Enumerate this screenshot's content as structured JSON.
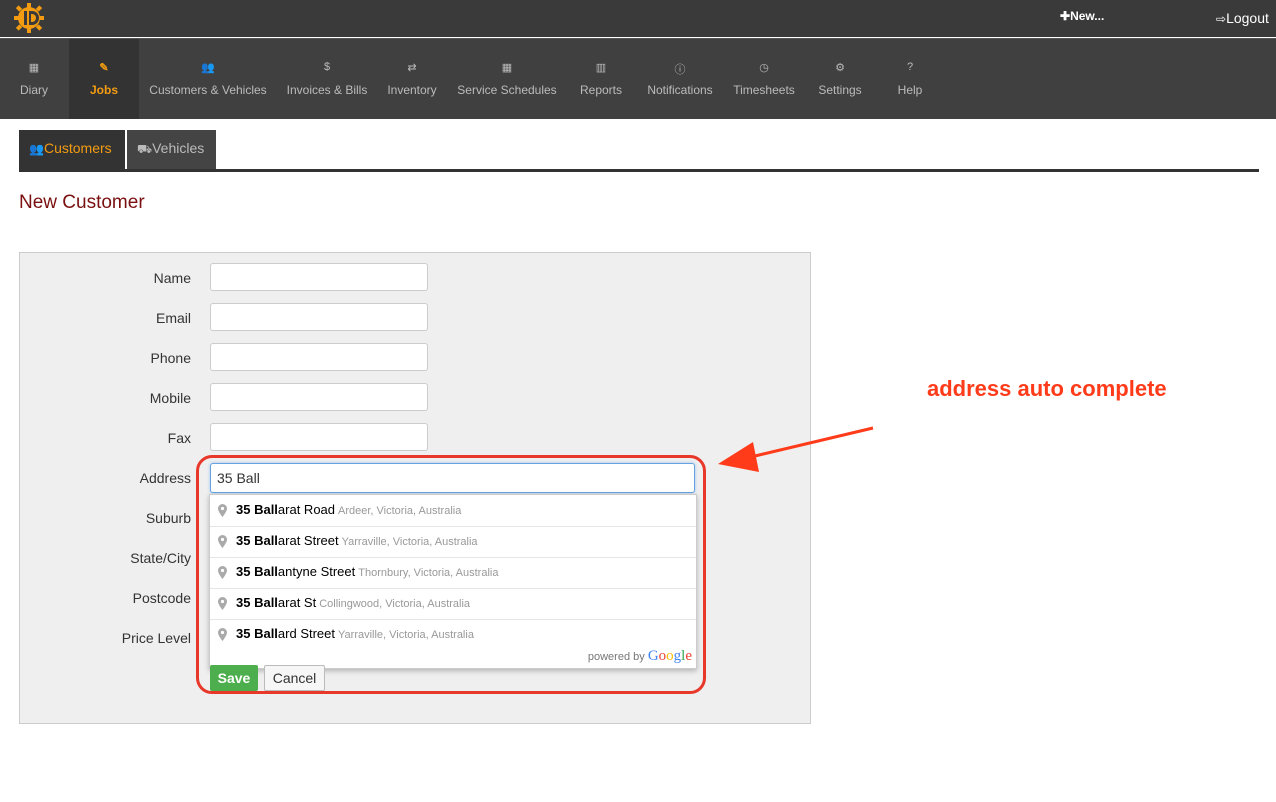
{
  "topbar": {
    "new_label": "New...",
    "logout_label": "Logout"
  },
  "nav": {
    "items": [
      {
        "label": "Diary",
        "icon": "calendar-icon",
        "glyph": "▦"
      },
      {
        "label": "Jobs",
        "icon": "wrench-icon",
        "glyph": "✎"
      },
      {
        "label": "Customers & Vehicles",
        "icon": "users-icon",
        "glyph": "👥"
      },
      {
        "label": "Invoices & Bills",
        "icon": "dollar-icon",
        "glyph": "$"
      },
      {
        "label": "Inventory",
        "icon": "retweet-icon",
        "glyph": "⇄"
      },
      {
        "label": "Service Schedules",
        "icon": "calendar-icon",
        "glyph": "▦"
      },
      {
        "label": "Reports",
        "icon": "bar-chart-icon",
        "glyph": "▥"
      },
      {
        "label": "Notifications",
        "icon": "info-icon",
        "glyph": "ⓘ"
      },
      {
        "label": "Timesheets",
        "icon": "clock-icon",
        "glyph": "◷"
      },
      {
        "label": "Settings",
        "icon": "gears-icon",
        "glyph": "⚙"
      },
      {
        "label": "Help",
        "icon": "question-icon",
        "glyph": "?"
      }
    ],
    "active": "Jobs"
  },
  "subtabs": {
    "customers": "Customers",
    "vehicles": "Vehicles"
  },
  "page_title": "New Customer",
  "form": {
    "labels": {
      "name": "Name",
      "email": "Email",
      "phone": "Phone",
      "mobile": "Mobile",
      "fax": "Fax",
      "address": "Address",
      "suburb": "Suburb",
      "state_city": "State/City",
      "postcode": "Postcode",
      "price_level": "Price Level"
    },
    "address_value": "35 Ball",
    "save_label": "Save",
    "cancel_label": "Cancel"
  },
  "autocomplete": {
    "suggestions": [
      {
        "match": "35 Ball",
        "rest": "arat Road",
        "sub": "Ardeer, Victoria, Australia"
      },
      {
        "match": "35 Ball",
        "rest": "arat Street",
        "sub": "Yarraville, Victoria, Australia"
      },
      {
        "match": "35 Ball",
        "rest": "antyne Street",
        "sub": "Thornbury, Victoria, Australia"
      },
      {
        "match": "35 Ball",
        "rest": "arat St",
        "sub": "Collingwood, Victoria, Australia"
      },
      {
        "match": "35 Ball",
        "rest": "ard Street",
        "sub": "Yarraville, Victoria, Australia"
      }
    ],
    "powered_by": "powered by",
    "brand": "Google"
  },
  "annotation": "address auto complete",
  "colors": {
    "accent": "#f39c12",
    "title": "#7a1010",
    "annotation": "#ff3b1a",
    "save": "#4cae4c"
  }
}
